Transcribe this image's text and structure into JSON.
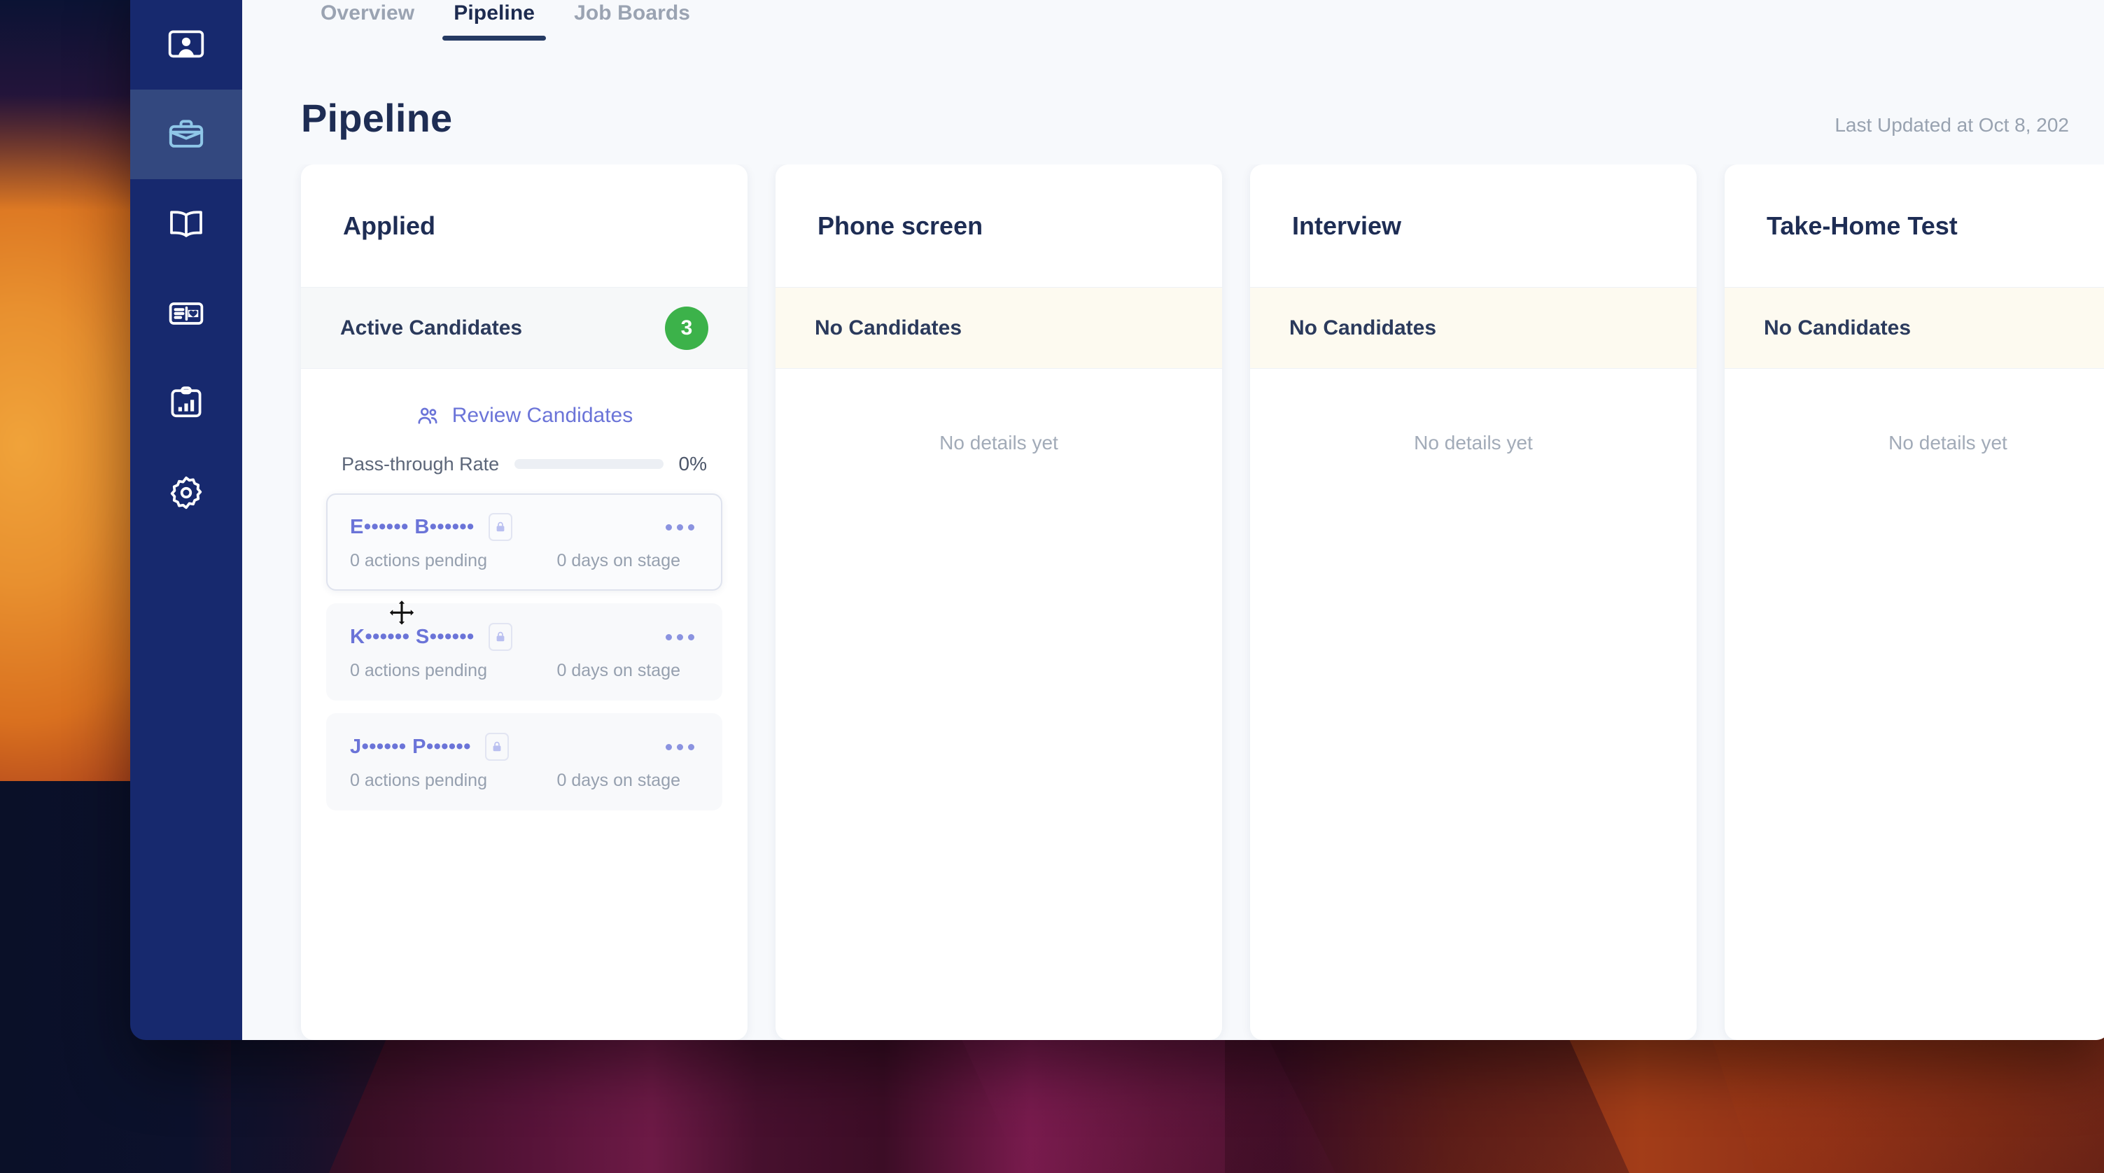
{
  "sidebar": {
    "items": [
      {
        "icon": "profile-card-icon",
        "active": false
      },
      {
        "icon": "briefcase-icon",
        "active": true
      },
      {
        "icon": "book-icon",
        "active": false
      },
      {
        "icon": "id-card-heart-icon",
        "active": false
      },
      {
        "icon": "clipboard-chart-icon",
        "active": false
      },
      {
        "icon": "gear-icon",
        "active": false
      }
    ]
  },
  "tabs": [
    {
      "label": "Overview",
      "active": false
    },
    {
      "label": "Pipeline",
      "active": true
    },
    {
      "label": "Job Boards",
      "active": false
    }
  ],
  "header": {
    "title": "Pipeline",
    "last_updated": "Last Updated at Oct 8, 202"
  },
  "board": {
    "review_link_label": "Review Candidates",
    "passthrough_label": "Pass-through Rate",
    "passthrough_value": "0%",
    "passthrough_percent": 0,
    "empty_details_text": "No details yet",
    "card_actions_label": "...",
    "columns": [
      {
        "title": "Applied",
        "status_label": "Active Candidates",
        "count": "3",
        "has_candidates": true,
        "candidates": [
          {
            "name": "E•••••• B••••••",
            "actions": "0 actions pending",
            "days": "0 days on stage",
            "locked": true,
            "selected": true
          },
          {
            "name": "K•••••• S••••••",
            "actions": "0 actions pending",
            "days": "0 days on stage",
            "locked": true,
            "selected": false
          },
          {
            "name": "J•••••• P••••••",
            "actions": "0 actions pending",
            "days": "0 days on stage",
            "locked": true,
            "selected": false
          }
        ]
      },
      {
        "title": "Phone screen",
        "status_label": "No Candidates",
        "count": null,
        "has_candidates": false,
        "candidates": []
      },
      {
        "title": "Interview",
        "status_label": "No Candidates",
        "count": null,
        "has_candidates": false,
        "candidates": []
      },
      {
        "title": "Take-Home Test",
        "status_label": "No Candidates",
        "count": null,
        "has_candidates": false,
        "candidates": []
      }
    ]
  },
  "colors": {
    "sidebar": "#17296e",
    "sidebar_active": "#33487f",
    "accent": "#6b74d8",
    "badge_green": "#3cb24a",
    "title": "#1e2d54",
    "empty_status_bg": "#fdfaf0"
  }
}
